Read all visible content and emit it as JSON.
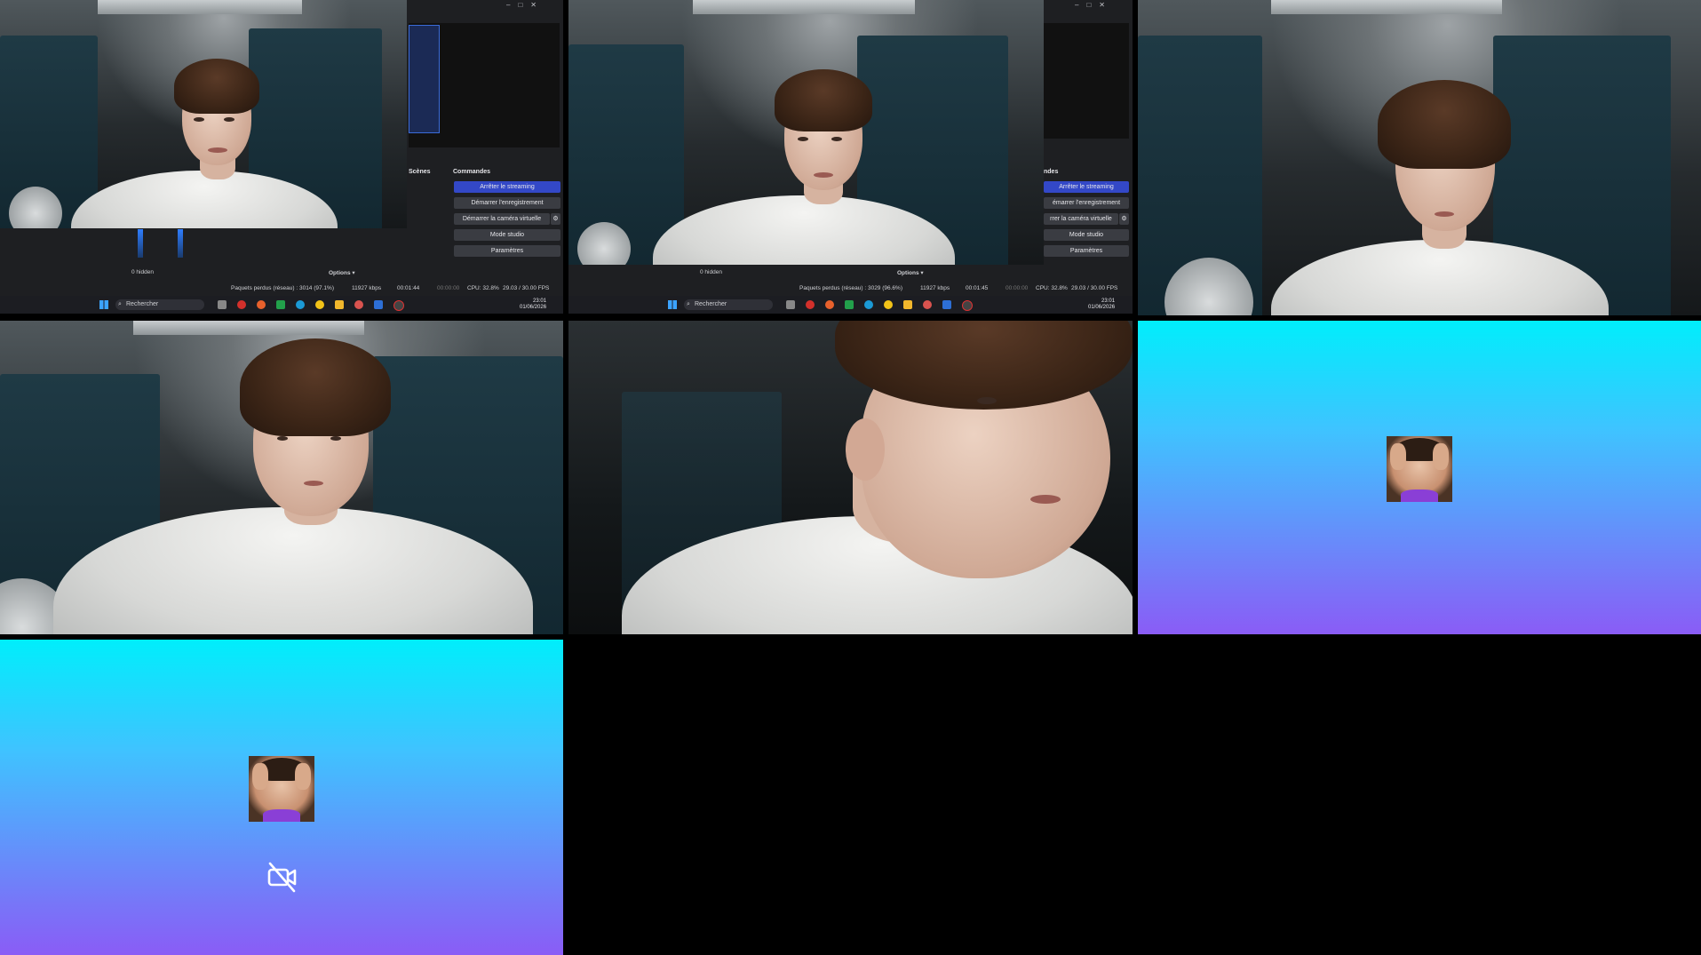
{
  "obs": {
    "panel_scenes": "Scènes",
    "panel_commands": "Commandes",
    "panel_commands_partial": "ndes",
    "btn_stop_stream": "Arrêter le streaming",
    "btn_start_record": "Démarrer l'enregistrement",
    "btn_start_vcam": "Démarrer la caméra virtuelle",
    "btn_start_vcam_partial": "rrer la caméra virtuelle",
    "btn_start_record_partial": "émarrer l'enregistrement",
    "btn_studio": "Mode studio",
    "btn_settings": "Paramètres",
    "hidden": "0 hidden",
    "options": "Options",
    "status_packets_1": "Paquets perdus (réseau) : 3014 (97.1%)",
    "status_packets_2": "Paquets perdus (réseau) : 3029 (96.6%)",
    "status_kbps": "11927 kbps",
    "status_time_1": "00:01:44",
    "status_time_2": "00:01:45",
    "status_rec": "00:00:00",
    "status_cpu": "CPU: 32.8%",
    "status_fps": "29.03 / 30.00 FPS"
  },
  "taskbar": {
    "search_placeholder": "Rechercher",
    "time": "23:01",
    "date": "01/06/2026"
  },
  "colors": {
    "primary_button": "#3348c7",
    "gradient_top": "#00eefc",
    "gradient_bottom": "#8a5cf6"
  },
  "icons": [
    "windows-start-icon",
    "search-icon",
    "camera-off-icon",
    "settings-gear-icon",
    "chevron-down-icon"
  ]
}
